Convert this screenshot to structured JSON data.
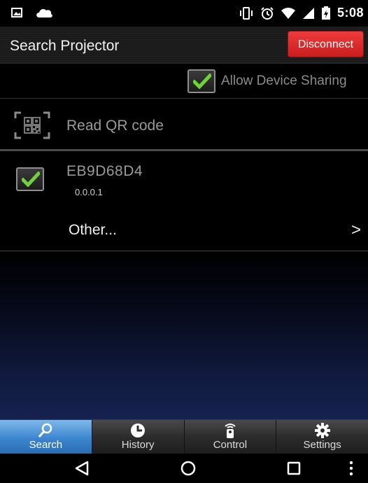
{
  "status_bar": {
    "time": "5:08",
    "icons": [
      "image-icon",
      "cloud-icon",
      "vibrate-icon",
      "alarm-icon",
      "wifi-icon",
      "cell-signal-icon",
      "battery-icon"
    ]
  },
  "action_bar": {
    "title": "Search Projector",
    "disconnect_label": "Disconnect"
  },
  "allow_sharing": {
    "label": "Allow Device Sharing",
    "checked": true
  },
  "qr": {
    "label": "Read QR code",
    "icon": "qr-code-icon"
  },
  "devices": [
    {
      "name": "EB9D68D4",
      "version": "0.0.0.1",
      "checked": true
    }
  ],
  "other": {
    "label": "Other...",
    "arrow": ">"
  },
  "tabs": [
    {
      "label": "Search",
      "icon": "search-icon",
      "active": true
    },
    {
      "label": "History",
      "icon": "clock-icon",
      "active": false
    },
    {
      "label": "Control",
      "icon": "remote-icon",
      "active": false
    },
    {
      "label": "Settings",
      "icon": "gear-icon",
      "active": false
    }
  ],
  "colors": {
    "disconnect": "#d82828",
    "active_tab": "#3c86cf",
    "check": "#6fd23a"
  }
}
